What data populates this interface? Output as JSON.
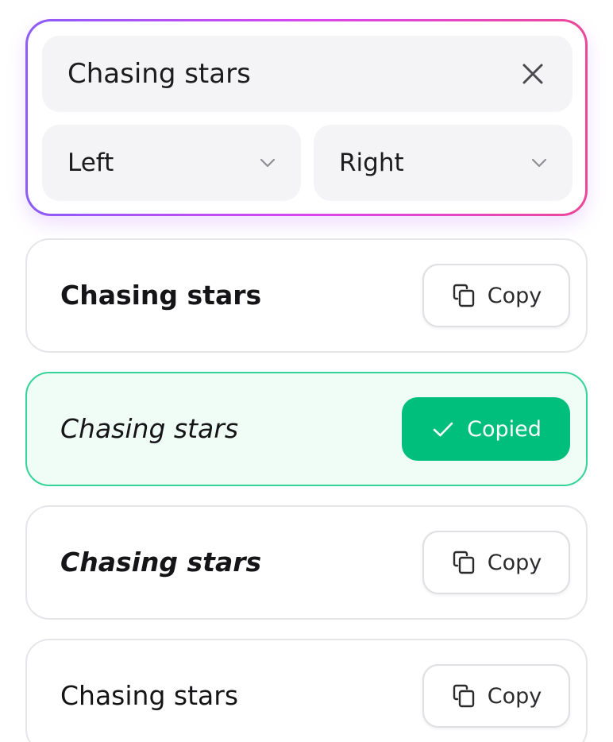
{
  "search": {
    "value": "Chasing stars"
  },
  "selects": {
    "left": {
      "label": "Left"
    },
    "right": {
      "label": "Right"
    }
  },
  "results": [
    {
      "text": "Chasing stars",
      "style": "bold",
      "button_label": "Copy",
      "copied": false
    },
    {
      "text": "Chasing stars",
      "style": "italic",
      "button_label": "Copied",
      "copied": true
    },
    {
      "text": "Chasing stars",
      "style": "bold-italic",
      "button_label": "Copy",
      "copied": false
    },
    {
      "text": "Chasing stars",
      "style": "regular",
      "button_label": "Copy",
      "copied": false
    }
  ],
  "icons": {
    "clear": "close-icon",
    "select": "chevron-down-icon",
    "copy": "copy-icon",
    "copied": "check-icon"
  },
  "colors": {
    "gradient_start": "#8b5cf6",
    "gradient_mid": "#d946ef",
    "gradient_end": "#ec4899",
    "copied_bg": "#00bf7d",
    "copied_row_border": "#34d399",
    "copied_row_bg": "#effdf6"
  }
}
